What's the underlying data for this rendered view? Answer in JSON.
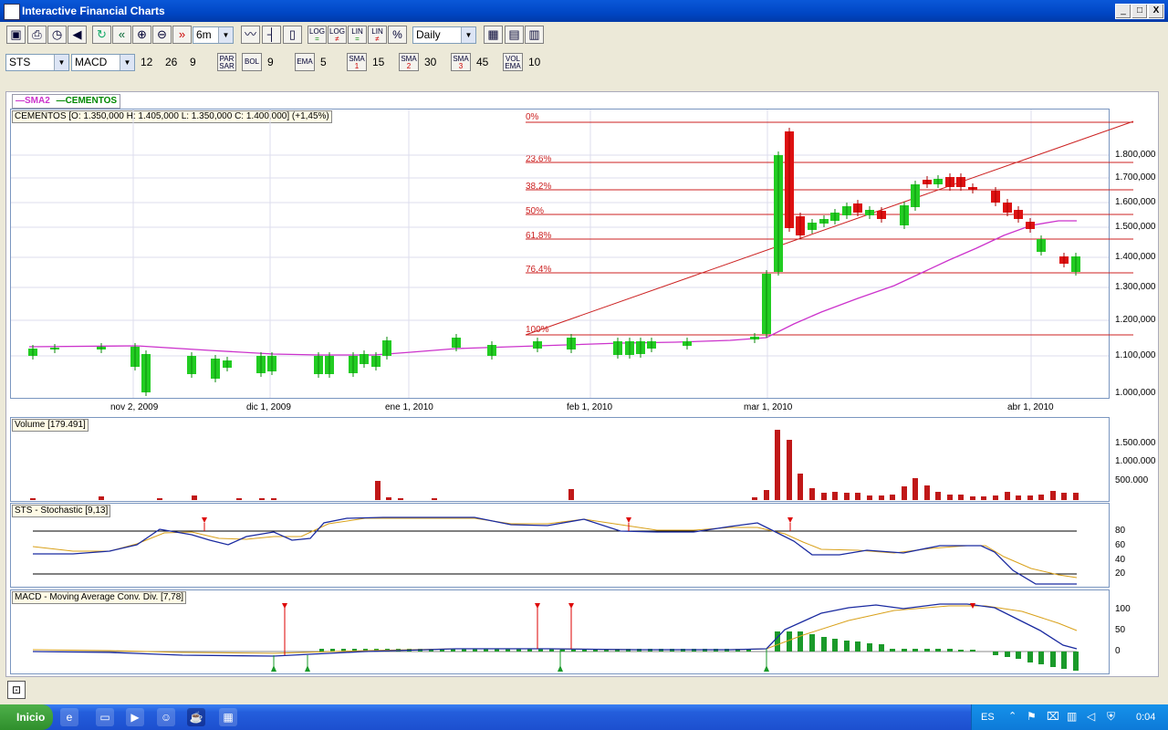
{
  "window": {
    "title": "Interactive Financial Charts",
    "min": "_",
    "max": "□",
    "close": "X"
  },
  "toolbar1": {
    "period": "6m",
    "log1_top": "LOG",
    "log1_bot": "=",
    "log2_top": "LOG",
    "log2_bot": "≠",
    "lin1_top": "LIN",
    "lin1_bot": "=",
    "lin2_top": "LIN",
    "lin2_bot": "≠",
    "pct": "%",
    "interval": "Daily"
  },
  "toolbar2": {
    "symbol": "STS",
    "indicator": "MACD",
    "macd_fast": "12",
    "macd_slow": "26",
    "macd_signal": "9",
    "par_sar_top": "PAR",
    "par_sar_bot": "SAR",
    "bol": "BOL",
    "bol_val": "9",
    "ema": "EMA",
    "ema_val": "5",
    "sma1_top": "SMA",
    "sma1_bot": "1",
    "sma1_val": "15",
    "sma2_top": "SMA",
    "sma2_bot": "2",
    "sma2_val": "30",
    "sma3_top": "SMA",
    "sma3_bot": "3",
    "sma3_val": "45",
    "volema_top": "VOL",
    "volema_bot": "EMA",
    "volema_val": "10"
  },
  "legend": {
    "sma2": "SMA2",
    "cementos": "CEMENTOS"
  },
  "price_panel": {
    "info": "CEMENTOS [O: 1.350,000  H: 1.405,000  L: 1.350,000  C: 1.400,000] (+1,45%)",
    "y_ticks": [
      "1.800,000",
      "1.700,000",
      "1.600,000",
      "1.500,000",
      "1.400,000",
      "1.300,000",
      "1.200,000",
      "1.100,000",
      "1.000,000"
    ],
    "x_ticks": [
      "nov 2, 2009",
      "dic 1, 2009",
      "ene 1, 2010",
      "feb 1, 2010",
      "mar 1, 2010",
      "abr 1, 2010"
    ],
    "fib_labels": [
      "0%",
      "23,6%",
      "38,2%",
      "50%",
      "61,8%",
      "76,4%",
      "100%"
    ],
    "colors": {
      "up": "#22cc22",
      "down": "#dd1111",
      "sma": "#cc33cc",
      "fib": "#cc2222"
    }
  },
  "volume_panel": {
    "label": "Volume [179.491]",
    "y_ticks": [
      "1.500.000",
      "1.000.000",
      "500.000"
    ]
  },
  "stoch_panel": {
    "label": "STS - Stochastic [9,13]",
    "y_ticks": [
      "80",
      "60",
      "40",
      "20"
    ]
  },
  "macd_panel": {
    "label": "MACD - Moving Average Conv. Div. [7,78]",
    "y_ticks": [
      "100",
      "50",
      "0"
    ]
  },
  "taskbar": {
    "start": "Inicio",
    "lang": "ES",
    "clock": "0:04"
  }
}
